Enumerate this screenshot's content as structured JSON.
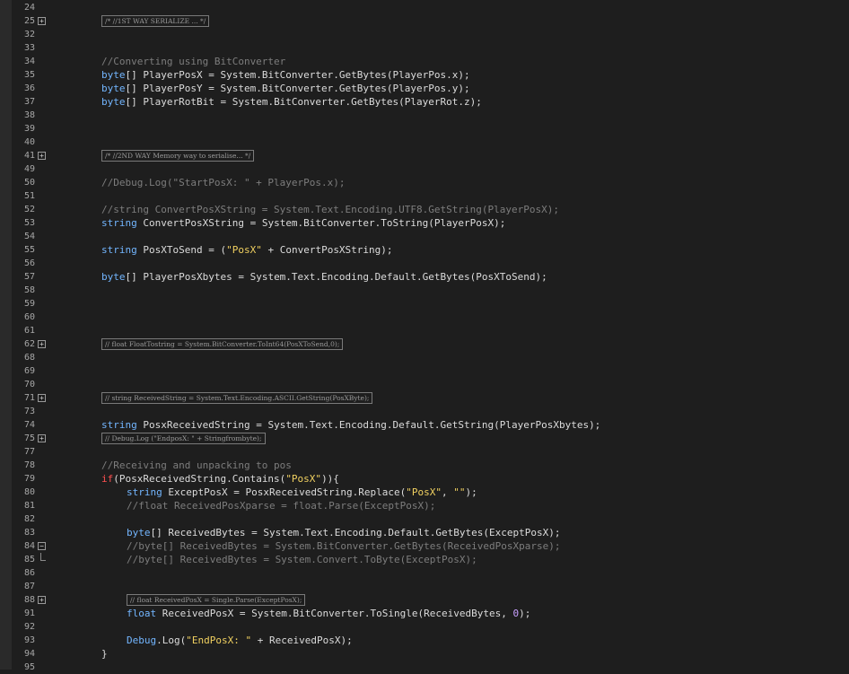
{
  "editor": {
    "lines": [
      {
        "n": "24"
      },
      {
        "n": "25",
        "fold": "+",
        "collapsed": "/* //1ST WAY SERIALIZE ... */",
        "indent": 0
      },
      {
        "n": "32"
      },
      {
        "n": "33"
      },
      {
        "n": "34",
        "indent": 0,
        "tokens": [
          {
            "t": "//Converting using BitConverter",
            "c": "cmt"
          }
        ]
      },
      {
        "n": "35",
        "indent": 0,
        "tokens": [
          {
            "t": "byte",
            "c": "kw"
          },
          {
            "t": "[] PlayerPosX = System.BitConverter.GetBytes(PlayerPos.x);",
            "c": ""
          }
        ]
      },
      {
        "n": "36",
        "indent": 0,
        "tokens": [
          {
            "t": "byte",
            "c": "kw"
          },
          {
            "t": "[] PlayerPosY = System.BitConverter.GetBytes(PlayerPos.y);",
            "c": ""
          }
        ]
      },
      {
        "n": "37",
        "indent": 0,
        "tokens": [
          {
            "t": "byte",
            "c": "kw"
          },
          {
            "t": "[] PlayerRotBit = System.BitConverter.GetBytes(PlayerRot.z);",
            "c": ""
          }
        ]
      },
      {
        "n": "38",
        "current": true
      },
      {
        "n": "39"
      },
      {
        "n": "40"
      },
      {
        "n": "41",
        "fold": "+",
        "collapsed": "/* //2ND WAY Memory way to serialise... */",
        "indent": 0
      },
      {
        "n": "49"
      },
      {
        "n": "50",
        "indent": 0,
        "tokens": [
          {
            "t": "//Debug.Log(\"StartPosX: \" + PlayerPos.x);",
            "c": "cmt"
          }
        ]
      },
      {
        "n": "51"
      },
      {
        "n": "52",
        "indent": 0,
        "tokens": [
          {
            "t": "//string ConvertPosXString = System.Text.Encoding.UTF8.GetString(PlayerPosX);",
            "c": "cmt"
          }
        ]
      },
      {
        "n": "53",
        "indent": 0,
        "tokens": [
          {
            "t": "string",
            "c": "kw"
          },
          {
            "t": " ConvertPosXString = System.BitConverter.ToString(PlayerPosX);",
            "c": ""
          }
        ]
      },
      {
        "n": "54"
      },
      {
        "n": "55",
        "indent": 0,
        "tokens": [
          {
            "t": "string",
            "c": "kw"
          },
          {
            "t": " PosXToSend = (",
            "c": ""
          },
          {
            "t": "\"PosX\"",
            "c": "str"
          },
          {
            "t": " + ConvertPosXString);",
            "c": ""
          }
        ]
      },
      {
        "n": "56"
      },
      {
        "n": "57",
        "indent": 0,
        "tokens": [
          {
            "t": "byte",
            "c": "kw"
          },
          {
            "t": "[] PlayerPosXbytes = System.Text.Encoding.Default.GetBytes(PosXToSend);",
            "c": ""
          }
        ]
      },
      {
        "n": "58"
      },
      {
        "n": "59"
      },
      {
        "n": "60"
      },
      {
        "n": "61"
      },
      {
        "n": "62",
        "fold": "+",
        "collapsed": "// float FloatTostring = System.BitConverter.ToInt64(PosXToSend,0);",
        "indent": 0
      },
      {
        "n": "68"
      },
      {
        "n": "69"
      },
      {
        "n": "70"
      },
      {
        "n": "71",
        "fold": "+",
        "collapsed": "// string ReceivedString = System.Text.Encoding.ASCII.GetString(PosXByte);",
        "indent": 0
      },
      {
        "n": "73"
      },
      {
        "n": "74",
        "indent": 0,
        "tokens": [
          {
            "t": "string",
            "c": "kw"
          },
          {
            "t": " PosxReceivedString = System.Text.Encoding.Default.GetString(PlayerPosXbytes);",
            "c": ""
          }
        ]
      },
      {
        "n": "75",
        "fold": "+",
        "collapsed": "// Debug.Log (\"EndposX: \" + Stringfrombyte);",
        "indent": 0
      },
      {
        "n": "77"
      },
      {
        "n": "78",
        "indent": 0,
        "tokens": [
          {
            "t": "//Receiving and unpacking to pos",
            "c": "cmt"
          }
        ]
      },
      {
        "n": "79",
        "indent": 0,
        "tokens": [
          {
            "t": "if",
            "c": "kwr"
          },
          {
            "t": "(PosxReceivedString.Contains(",
            "c": ""
          },
          {
            "t": "\"PosX\"",
            "c": "str"
          },
          {
            "t": ")){",
            "c": ""
          }
        ]
      },
      {
        "n": "80",
        "indent": 1,
        "tokens": [
          {
            "t": "string",
            "c": "kw"
          },
          {
            "t": " ExceptPosX = PosxReceivedString.Replace(",
            "c": ""
          },
          {
            "t": "\"PosX\"",
            "c": "str"
          },
          {
            "t": ", ",
            "c": ""
          },
          {
            "t": "\"\"",
            "c": "str"
          },
          {
            "t": ");",
            "c": ""
          }
        ]
      },
      {
        "n": "81",
        "indent": 1,
        "tokens": [
          {
            "t": "//float ReceivedPosXparse = float.Parse(ExceptPosX);",
            "c": "cmt"
          }
        ]
      },
      {
        "n": "82"
      },
      {
        "n": "83",
        "indent": 1,
        "tokens": [
          {
            "t": "byte",
            "c": "kw"
          },
          {
            "t": "[] ReceivedBytes = System.Text.Encoding.Default.GetBytes(ExceptPosX);",
            "c": ""
          }
        ]
      },
      {
        "n": "84",
        "fold": "−",
        "indent": 1,
        "tokens": [
          {
            "t": "//byte[] ReceivedBytes = System.BitConverter.GetBytes(ReceivedPosXparse);",
            "c": "cmt"
          }
        ]
      },
      {
        "n": "85",
        "foldend": true,
        "indent": 1,
        "tokens": [
          {
            "t": "//byte[] ReceivedBytes = System.Convert.ToByte(ExceptPosX);",
            "c": "cmt"
          }
        ]
      },
      {
        "n": "86"
      },
      {
        "n": "87"
      },
      {
        "n": "88",
        "fold": "+",
        "collapsed": "// float ReceivedPosX = Single.Parse(ExceptPosX);",
        "indent": 1
      },
      {
        "n": "91",
        "indent": 1,
        "tokens": [
          {
            "t": "float",
            "c": "kw"
          },
          {
            "t": " ReceivedPosX = System.BitConverter.ToSingle(ReceivedBytes, ",
            "c": ""
          },
          {
            "t": "0",
            "c": "num"
          },
          {
            "t": ");",
            "c": ""
          }
        ]
      },
      {
        "n": "92"
      },
      {
        "n": "93",
        "indent": 1,
        "tokens": [
          {
            "t": "Debug",
            "c": "kw"
          },
          {
            "t": ".Log(",
            "c": ""
          },
          {
            "t": "\"EndPosX: \"",
            "c": "str"
          },
          {
            "t": " + ReceivedPosX);",
            "c": ""
          }
        ]
      },
      {
        "n": "94",
        "indent": 0,
        "tokens": [
          {
            "t": "}",
            "c": ""
          }
        ]
      },
      {
        "n": "95"
      }
    ]
  }
}
